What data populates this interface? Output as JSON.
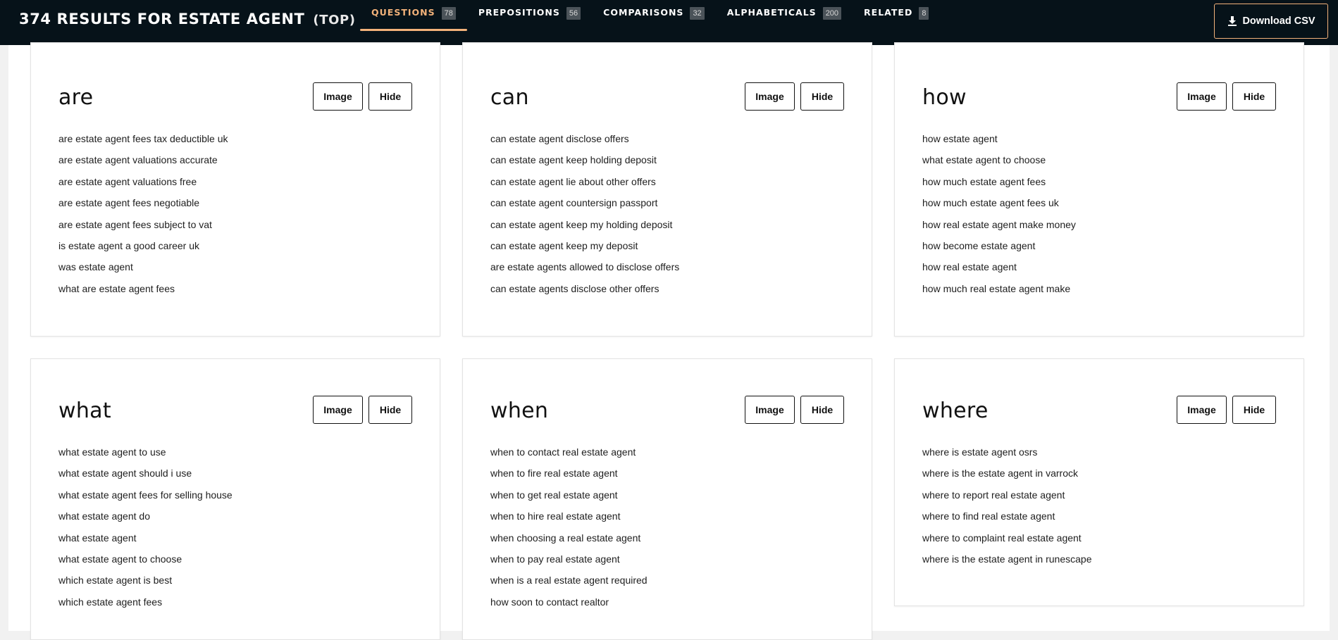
{
  "header": {
    "results_title": "374 RESULTS FOR ESTATE AGENT",
    "mode": "(TOP)",
    "tabs": [
      {
        "label": "QUESTIONS",
        "count": "78"
      },
      {
        "label": "PREPOSITIONS",
        "count": "56"
      },
      {
        "label": "COMPARISONS",
        "count": "32"
      },
      {
        "label": "ALPHABETICALS",
        "count": "200"
      },
      {
        "label": "RELATED",
        "count": "8"
      }
    ],
    "download_label": "Download CSV",
    "download_icon": "download-icon"
  },
  "colors": {
    "topbar": "#061219",
    "accent": "#f3b27a"
  },
  "cards": [
    {
      "title": "are",
      "image_label": "Image",
      "hide_label": "Hide",
      "items": [
        "are estate agent fees tax deductible uk",
        "are estate agent valuations accurate",
        "are estate agent valuations free",
        "are estate agent fees negotiable",
        "are estate agent fees subject to vat",
        "is estate agent a good career uk",
        "was estate agent",
        "what are estate agent fees"
      ]
    },
    {
      "title": "can",
      "image_label": "Image",
      "hide_label": "Hide",
      "items": [
        "can estate agent disclose offers",
        "can estate agent keep holding deposit",
        "can estate agent lie about other offers",
        "can estate agent countersign passport",
        "can estate agent keep my holding deposit",
        "can estate agent keep my deposit",
        "are estate agents allowed to disclose offers",
        "can estate agents disclose other offers"
      ]
    },
    {
      "title": "how",
      "image_label": "Image",
      "hide_label": "Hide",
      "items": [
        "how estate agent",
        "what estate agent to choose",
        "how much estate agent fees",
        "how much estate agent fees uk",
        "how real estate agent make money",
        "how become estate agent",
        "how real estate agent",
        "how much real estate agent make"
      ]
    },
    {
      "title": "what",
      "image_label": "Image",
      "hide_label": "Hide",
      "items": [
        "what estate agent to use",
        "what estate agent should i use",
        "what estate agent fees for selling house",
        "what estate agent do",
        "what estate agent",
        "what estate agent to choose",
        "which estate agent is best",
        "which estate agent fees"
      ]
    },
    {
      "title": "when",
      "image_label": "Image",
      "hide_label": "Hide",
      "items": [
        "when to contact real estate agent",
        "when to fire real estate agent",
        "when to get real estate agent",
        "when to hire real estate agent",
        "when choosing a real estate agent",
        "when to pay real estate agent",
        "when is a real estate agent required",
        "how soon to contact realtor"
      ]
    },
    {
      "title": "where",
      "image_label": "Image",
      "hide_label": "Hide",
      "items": [
        "where is estate agent osrs",
        "where is the estate agent in varrock",
        "where to report real estate agent",
        "where to find real estate agent",
        "where to complaint real estate agent",
        "where is the estate agent in runescape"
      ]
    }
  ]
}
